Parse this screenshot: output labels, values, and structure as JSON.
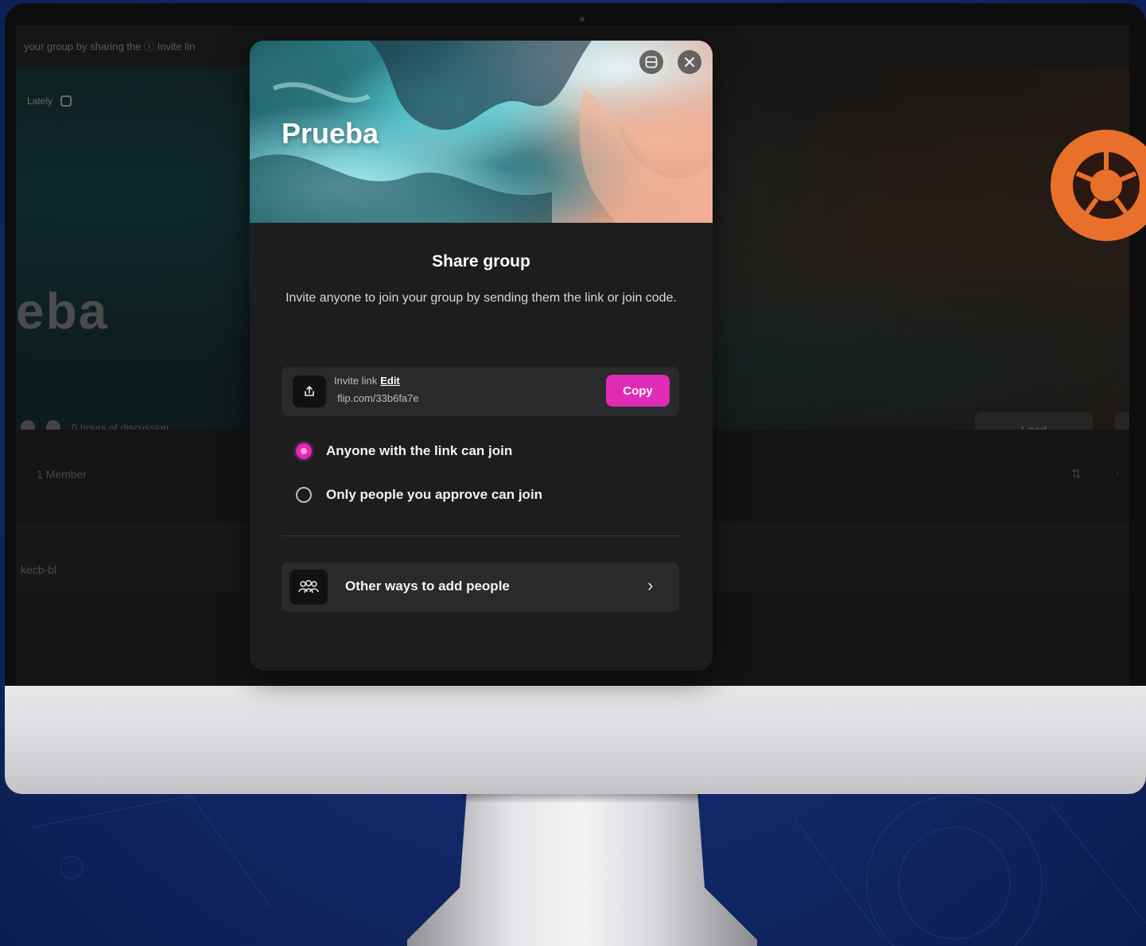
{
  "background_app": {
    "topbar_text": "your group by sharing the ⓘ Invite lin",
    "badge_text": "Lately",
    "hero_title": "eba",
    "meta_text": "0 hours of discussion",
    "lead_button": "Lead",
    "members_text": "1 Member",
    "member_name": "kecb-bl"
  },
  "modal": {
    "cover_title": "Prueba",
    "heading": "Share group",
    "description": "Invite anyone to join your group by sending them the link or join code.",
    "invite": {
      "label": "Invite link",
      "edit_label": "Edit",
      "url": "flip.com/33b6fa7e",
      "copy_label": "Copy"
    },
    "options": [
      {
        "label": "Anyone with the link can join",
        "selected": true
      },
      {
        "label": "Only people you approve can join",
        "selected": false
      }
    ],
    "other_ways_label": "Other ways to add people"
  },
  "colors": {
    "accent": "#e02bb4",
    "logo": "#e8702a",
    "modal_bg": "#1d1d1f",
    "page_bg": "#142b6e"
  },
  "icons": [
    "qr-code-icon",
    "close-icon",
    "share-upload-icon",
    "group-people-icon",
    "chevron-right-icon",
    "brand-logo-icon",
    "sort-icon"
  ]
}
